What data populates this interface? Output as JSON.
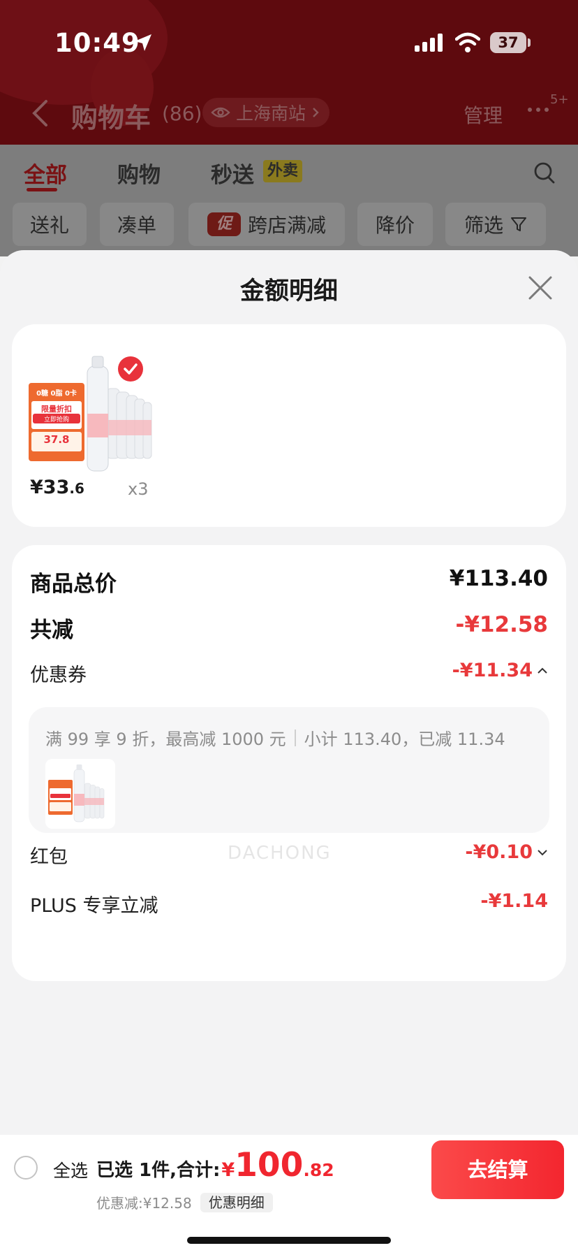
{
  "status_bar": {
    "time": "10:49",
    "battery": "37"
  },
  "nav": {
    "title": "购物车",
    "count": "(86)",
    "location": "上海南站",
    "manage": "管理",
    "more_badge": "5+"
  },
  "tabs": [
    {
      "label": "全部",
      "active": true
    },
    {
      "label": "购物",
      "active": false
    },
    {
      "label": "秒送",
      "active": false,
      "tag": "外卖"
    }
  ],
  "chips": [
    {
      "label": "送礼"
    },
    {
      "label": "凑单"
    },
    {
      "label": "跨店满减",
      "badge": "促"
    },
    {
      "label": "降价"
    },
    {
      "label": "筛选"
    }
  ],
  "sheet": {
    "title": "金额明细",
    "product": {
      "price_int": "¥33",
      "price_dec": ".6",
      "quantity": "x3",
      "image_lines": [
        "0糖 0脂 0卡",
        "限量折扣",
        "立即抢购",
        "37.8"
      ]
    },
    "rows": {
      "subtotal": {
        "label": "商品总价",
        "value": "¥113.40"
      },
      "total_off": {
        "label": "共减",
        "value": "-¥12.58"
      },
      "coupon": {
        "label": "优惠券",
        "value": "-¥11.34"
      },
      "red_packet": {
        "label": "红包",
        "value": "-¥0.10"
      },
      "plus": {
        "label": "PLUS 专享立减",
        "value": "-¥1.14"
      }
    },
    "coupon_detail": {
      "rule": "满 99 享 9 折，最高减 1000 元",
      "summary": "小计 113.40，已减 11.34"
    },
    "watermark": "DACHONG"
  },
  "bottom_bar": {
    "select_all": "全选",
    "selected_prefix": "已选 1件,合计:",
    "total_symbol": "¥",
    "total_int": "100",
    "total_dec": ".82",
    "discount": "优惠减:¥12.58",
    "detail_button": "优惠明细",
    "checkout": "去结算"
  },
  "colors": {
    "accent_red": "#e8393b",
    "checkout_red": "#f3262f",
    "header_bg": "#5e0a0e"
  }
}
